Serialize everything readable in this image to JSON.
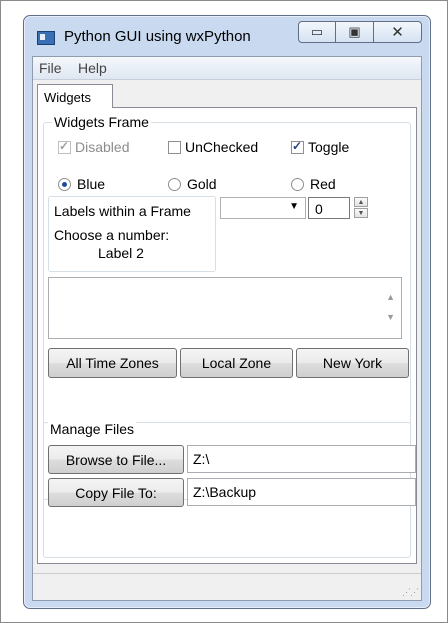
{
  "window": {
    "title": "Python GUI using wxPython"
  },
  "menu": {
    "items": [
      "File",
      "Help"
    ]
  },
  "tabs": [
    {
      "label": "Widgets"
    }
  ],
  "widgets_frame": {
    "label": "Widgets Frame",
    "checkboxes": [
      {
        "label": "Disabled",
        "checked": true,
        "enabled": false
      },
      {
        "label": "UnChecked",
        "checked": false,
        "enabled": true
      },
      {
        "label": "Toggle",
        "checked": true,
        "enabled": true
      }
    ],
    "radios": [
      {
        "label": "Blue",
        "selected": true
      },
      {
        "label": "Gold",
        "selected": false
      },
      {
        "label": "Red",
        "selected": false
      }
    ],
    "labels_frame": {
      "label": "Labels within a Frame",
      "choose": "Choose a number:",
      "label2": "Label 2"
    },
    "combo": {
      "value": ""
    },
    "spin": {
      "value": "0"
    },
    "buttons": [
      "All Time Zones",
      "Local Zone",
      "New York"
    ]
  },
  "manage_files": {
    "label": "Manage Files",
    "browse_button": "Browse to File...",
    "browse_value": "Z:\\",
    "copy_button": "Copy File To:",
    "copy_value": "Z:\\Backup"
  }
}
